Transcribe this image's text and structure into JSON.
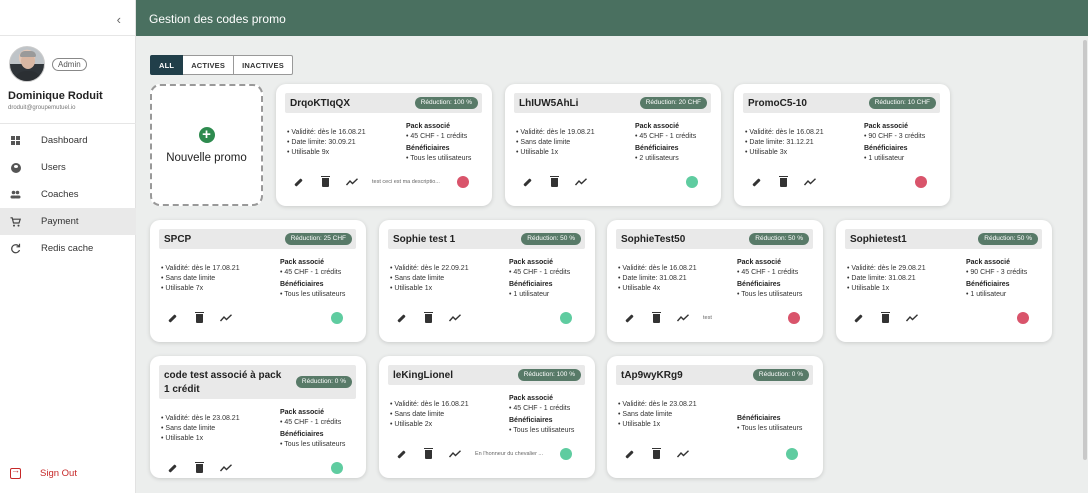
{
  "header": {
    "title": "Gestion des codes promo"
  },
  "sidebar": {
    "collapse_icon": "chevron-left-icon",
    "user": {
      "role": "Admin",
      "name": "Dominique Roduit",
      "email": "droduit@groupemutuel.io"
    },
    "items": [
      {
        "label": "Dashboard",
        "icon": "dashboard-icon",
        "active": false
      },
      {
        "label": "Users",
        "icon": "account-circle-icon",
        "active": false
      },
      {
        "label": "Coaches",
        "icon": "people-icon",
        "active": false
      },
      {
        "label": "Payment",
        "icon": "cart-icon",
        "active": true
      },
      {
        "label": "Redis cache",
        "icon": "refresh-icon",
        "active": false
      }
    ],
    "signout": "Sign Out"
  },
  "filters": {
    "selected": "ALL",
    "options": [
      "ALL",
      "ACTIVES",
      "INACTIVES"
    ]
  },
  "new_promo": {
    "label": "Nouvelle promo",
    "icon": "plus-circle-icon"
  },
  "colors": {
    "header": "#4a7060",
    "active_dot": "#5fcca0",
    "inactive_dot": "#d9546b",
    "badge": "#587a68",
    "selected_filter": "#213f4a"
  },
  "labels": {
    "pack": "Pack associé",
    "benef": "Bénéficiaires"
  },
  "promos": [
    {
      "code": "DrqoKTIqQX",
      "reduction": "Réduction: 100 %",
      "validity": "• Validité: dès le 16.08.21",
      "limit": "• Date limite: 30.09.21",
      "usage": "• Utilisable 9x",
      "pack": "• 45 CHF - 1 crédits",
      "benef": "• Tous les utilisateurs",
      "desc": "test ceci est ma descriptio...",
      "status": "red"
    },
    {
      "code": "LhIUW5AhLi",
      "reduction": "Réduction: 20 CHF",
      "validity": "• Validité: dès le 19.08.21",
      "limit": "• Sans date limite",
      "usage": "• Utilisable 1x",
      "pack": "• 45 CHF - 1 crédits",
      "benef": "• 2 utilisateurs",
      "desc": "",
      "status": "green"
    },
    {
      "code": "PromoC5-10",
      "reduction": "Réduction: 10 CHF",
      "validity": "• Validité: dès le 16.08.21",
      "limit": "• Date limite: 31.12.21",
      "usage": "• Utilisable 3x",
      "pack": "• 90 CHF - 3 crédits",
      "benef": "• 1 utilisateur",
      "desc": "",
      "status": "red"
    },
    {
      "code": "SPCP",
      "reduction": "Réduction: 25 CHF",
      "validity": "• Validité: dès le 17.08.21",
      "limit": "• Sans date limite",
      "usage": "• Utilisable 7x",
      "pack": "• 45 CHF - 1 crédits",
      "benef": "• Tous les utilisateurs",
      "desc": "",
      "status": "green"
    },
    {
      "code": "Sophie test 1",
      "reduction": "Réduction: 50 %",
      "validity": "• Validité: dès le 22.09.21",
      "limit": "• Sans date limite",
      "usage": "• Utilisable 1x",
      "pack": "• 45 CHF - 1 crédits",
      "benef": "• 1 utilisateur",
      "desc": "",
      "status": "green"
    },
    {
      "code": "SophieTest50",
      "reduction": "Réduction: 50 %",
      "validity": "• Validité: dès le 16.08.21",
      "limit": "• Date limite: 31.08.21",
      "usage": "• Utilisable 4x",
      "pack": "• 45 CHF - 1 crédits",
      "benef": "• Tous les utilisateurs",
      "desc": "test",
      "status": "red"
    },
    {
      "code": "Sophietest1",
      "reduction": "Réduction: 50 %",
      "validity": "• Validité: dès le 29.08.21",
      "limit": "• Date limite: 31.08.21",
      "usage": "• Utilisable 1x",
      "pack": "• 90 CHF - 3 crédits",
      "benef": "• 1 utilisateur",
      "desc": "",
      "status": "red"
    },
    {
      "code": "code test associé à pack 1 crédit",
      "reduction": "Réduction: 0 %",
      "validity": "• Validité: dès le 23.08.21",
      "limit": "• Sans date limite",
      "usage": "• Utilisable 1x",
      "pack": "• 45 CHF - 1 crédits",
      "benef": "• Tous les utilisateurs",
      "desc": "",
      "status": "green"
    },
    {
      "code": "leKingLionel",
      "reduction": "Réduction: 100 %",
      "validity": "• Validité: dès le 16.08.21",
      "limit": "• Sans date limite",
      "usage": "• Utilisable 2x",
      "pack": "• 45 CHF - 1 crédits",
      "benef": "• Tous les utilisateurs",
      "desc": "En l'honneur du chevalier ...",
      "status": "green"
    },
    {
      "code": "tAp9wyKRg9",
      "reduction": "Réduction: 0 %",
      "validity": "• Validité: dès le 23.08.21",
      "limit": "• Sans date limite",
      "usage": "• Utilisable 1x",
      "pack": "",
      "benef": "• Tous les utilisateurs",
      "desc": "",
      "status": "green"
    }
  ]
}
